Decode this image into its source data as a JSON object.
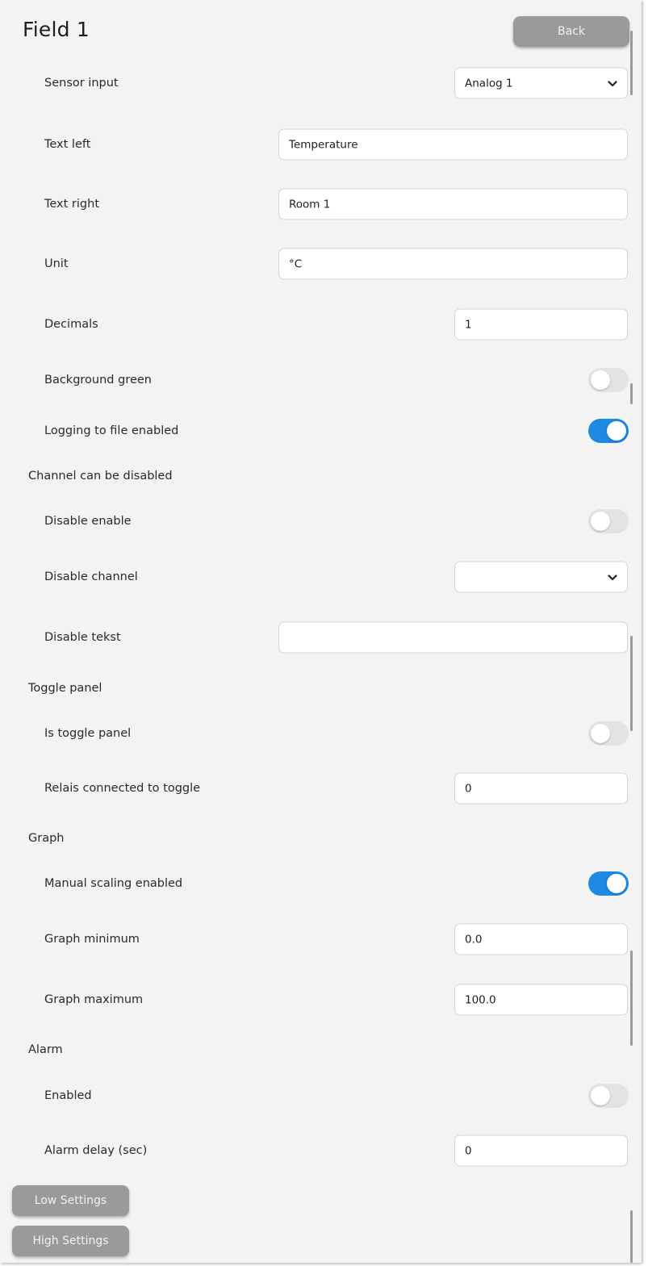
{
  "header": {
    "title": "Field 1",
    "back_label": "Back"
  },
  "fields": {
    "sensor_input": {
      "label": "Sensor input",
      "value": "Analog 1"
    },
    "text_left": {
      "label": "Text left",
      "value": "Temperature"
    },
    "text_right": {
      "label": "Text right",
      "value": "Room 1"
    },
    "unit": {
      "label": "Unit",
      "value": "°C"
    },
    "decimals": {
      "label": "Decimals",
      "value": "1"
    },
    "background_green": {
      "label": "Background green",
      "checked": false
    },
    "logging_enabled": {
      "label": "Logging to file enabled",
      "checked": true
    }
  },
  "disable_section": {
    "title": "Channel can be disabled",
    "disable_enable": {
      "label": "Disable enable",
      "checked": false
    },
    "disable_channel": {
      "label": "Disable channel",
      "value": ""
    },
    "disable_tekst": {
      "label": "Disable tekst",
      "value": ""
    }
  },
  "toggle_section": {
    "title": "Toggle panel",
    "is_toggle_panel": {
      "label": "Is toggle panel",
      "checked": false
    },
    "relais": {
      "label": "Relais connected to toggle",
      "value": "0"
    }
  },
  "graph_section": {
    "title": "Graph",
    "manual_scaling": {
      "label": "Manual scaling enabled",
      "checked": true
    },
    "graph_min": {
      "label": "Graph minimum",
      "value": "0.0"
    },
    "graph_max": {
      "label": "Graph maximum",
      "value": "100.0"
    }
  },
  "alarm_section": {
    "title": "Alarm",
    "enabled": {
      "label": "Enabled",
      "checked": false
    },
    "delay": {
      "label": "Alarm delay (sec)",
      "value": "0"
    }
  },
  "footer": {
    "low_settings_label": "Low Settings",
    "high_settings_label": "High Settings"
  },
  "colors": {
    "accent": "#1e88e5",
    "button_gray": "#9a9a9a",
    "background": "#f3f3f3"
  }
}
